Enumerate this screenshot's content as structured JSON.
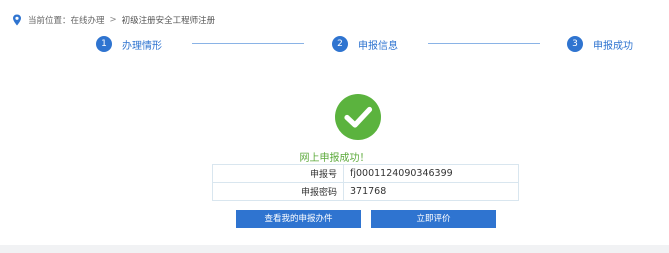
{
  "breadcrumb": {
    "location_label": "当前位置：",
    "items": [
      "在线办理",
      "初级注册安全工程师注册"
    ],
    "separator": ">"
  },
  "steps": [
    {
      "number": "1",
      "label": "办理情形"
    },
    {
      "number": "2",
      "label": "申报信息"
    },
    {
      "number": "3",
      "label": "申报成功"
    }
  ],
  "result": {
    "message": "网上申报成功！",
    "rows": [
      {
        "key": "申报号",
        "value": "fj0001124090346399"
      },
      {
        "key": "申报密码",
        "value": "371768"
      }
    ]
  },
  "actions": {
    "view_label": "查看我的申报办件",
    "rate_label": "立即评价"
  },
  "colors": {
    "accent": "#2f74d0",
    "success": "#5bb33e"
  }
}
